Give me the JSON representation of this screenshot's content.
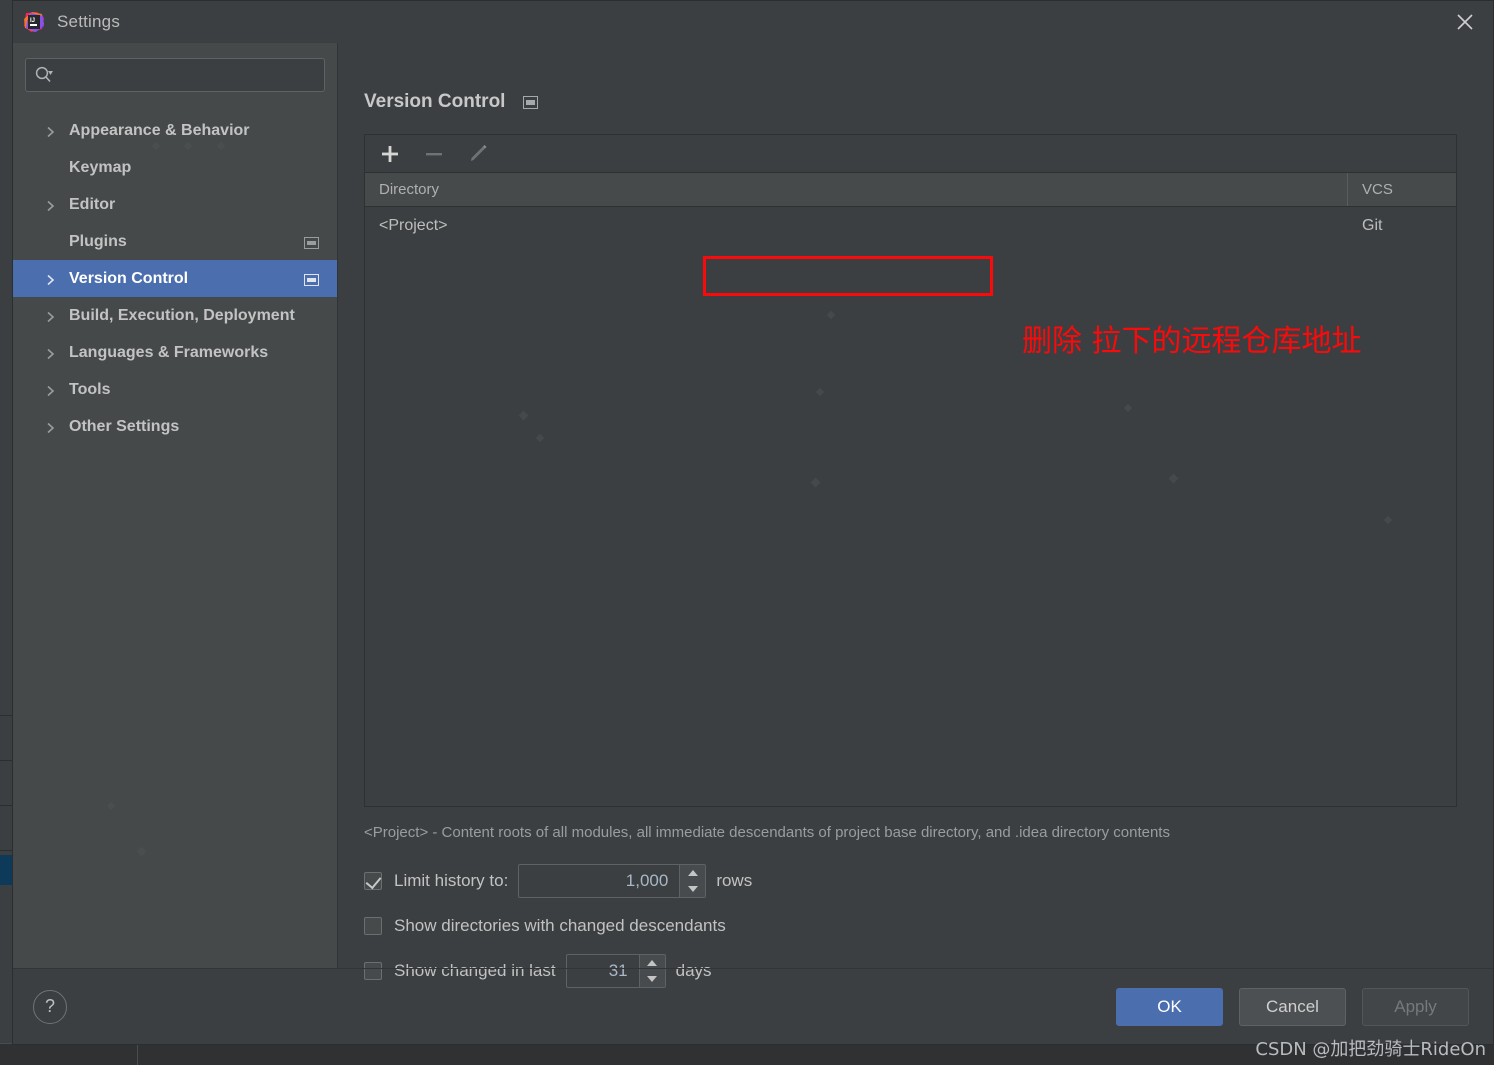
{
  "window": {
    "title": "Settings",
    "app_icon": "intellij-idea-icon",
    "close_icon": "close-icon"
  },
  "sidebar": {
    "search": {
      "value": "",
      "placeholder": "",
      "icon": "search-dropdown-icon"
    },
    "items": [
      {
        "label": "Appearance & Behavior",
        "expandable": true,
        "selected": false,
        "badge": false
      },
      {
        "label": "Keymap",
        "expandable": false,
        "selected": false,
        "badge": false
      },
      {
        "label": "Editor",
        "expandable": true,
        "selected": false,
        "badge": false
      },
      {
        "label": "Plugins",
        "expandable": false,
        "selected": false,
        "badge": true
      },
      {
        "label": "Version Control",
        "expandable": true,
        "selected": true,
        "badge": true
      },
      {
        "label": "Build, Execution, Deployment",
        "expandable": true,
        "selected": false,
        "badge": false
      },
      {
        "label": "Languages & Frameworks",
        "expandable": true,
        "selected": false,
        "badge": false
      },
      {
        "label": "Tools",
        "expandable": true,
        "selected": false,
        "badge": false
      },
      {
        "label": "Other Settings",
        "expandable": true,
        "selected": false,
        "badge": false
      }
    ]
  },
  "main": {
    "title": "Version Control",
    "title_badge": "project-scope-badge-icon",
    "toolbar": [
      {
        "name": "add-button",
        "icon": "plus-icon",
        "enabled": true
      },
      {
        "name": "remove-button",
        "icon": "minus-icon",
        "enabled": false
      },
      {
        "name": "edit-button",
        "icon": "pencil-icon",
        "enabled": false
      }
    ],
    "table": {
      "columns": [
        "Directory",
        "VCS"
      ],
      "rows": [
        {
          "directory": "<Project>",
          "vcs": "Git"
        }
      ]
    },
    "project_note": "<Project> - Content roots of all modules, all immediate descendants of project base directory, and .idea directory contents",
    "options": [
      {
        "name": "limit-history",
        "label": "Limit history to:",
        "checked": true,
        "spinner_value": "1,000",
        "suffix": "rows"
      },
      {
        "name": "show-directories-changed-descendants",
        "label": "Show directories with changed descendants",
        "checked": false,
        "spinner_value": null,
        "suffix": null
      },
      {
        "name": "show-changed-in-last",
        "label": "Show changed in last",
        "checked": false,
        "spinner_value": "31",
        "suffix": "days"
      }
    ]
  },
  "annotations": {
    "red_note": "删除 拉下的远程仓库地址",
    "red_box_color": "#fa0a0a"
  },
  "footer": {
    "help_icon": "question-mark-icon",
    "help_label": "?",
    "ok_label": "OK",
    "cancel_label": "Cancel",
    "apply_label": "Apply",
    "apply_enabled": false
  },
  "watermark": "CSDN @加把劲骑士RideOn",
  "colors": {
    "dialog_bg": "#3c3f41",
    "sidebar_bg": "#45494a",
    "accent_blue": "#4b6eaf",
    "annotation_red": "#fa0a0a",
    "text_primary": "#c3c3c3",
    "text_muted": "#9a9da0"
  }
}
